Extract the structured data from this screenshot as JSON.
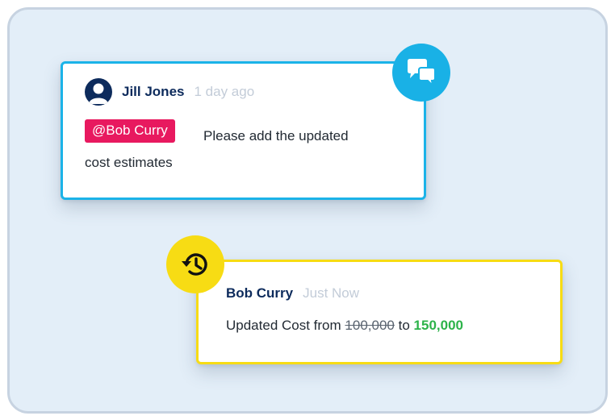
{
  "comment": {
    "author": "Jill Jones",
    "time": "1 day ago",
    "mention": "@Bob Curry",
    "text_line1": "Please add the updated",
    "text_line2": "cost estimates",
    "accent_color": "#1bb3e8",
    "badge_icon": "chat-bubbles-icon",
    "avatar_icon": "user-avatar-icon"
  },
  "update": {
    "author": "Bob Curry",
    "time": "Just Now",
    "prefix": "Updated Cost from",
    "old_value": "100,000",
    "connector": "to",
    "new_value": "150,000",
    "accent_color": "#f7dc14",
    "badge_icon": "history-icon",
    "new_value_color": "#2db34a"
  },
  "mention_color": "#e8195f",
  "author_color": "#0d2b5c"
}
